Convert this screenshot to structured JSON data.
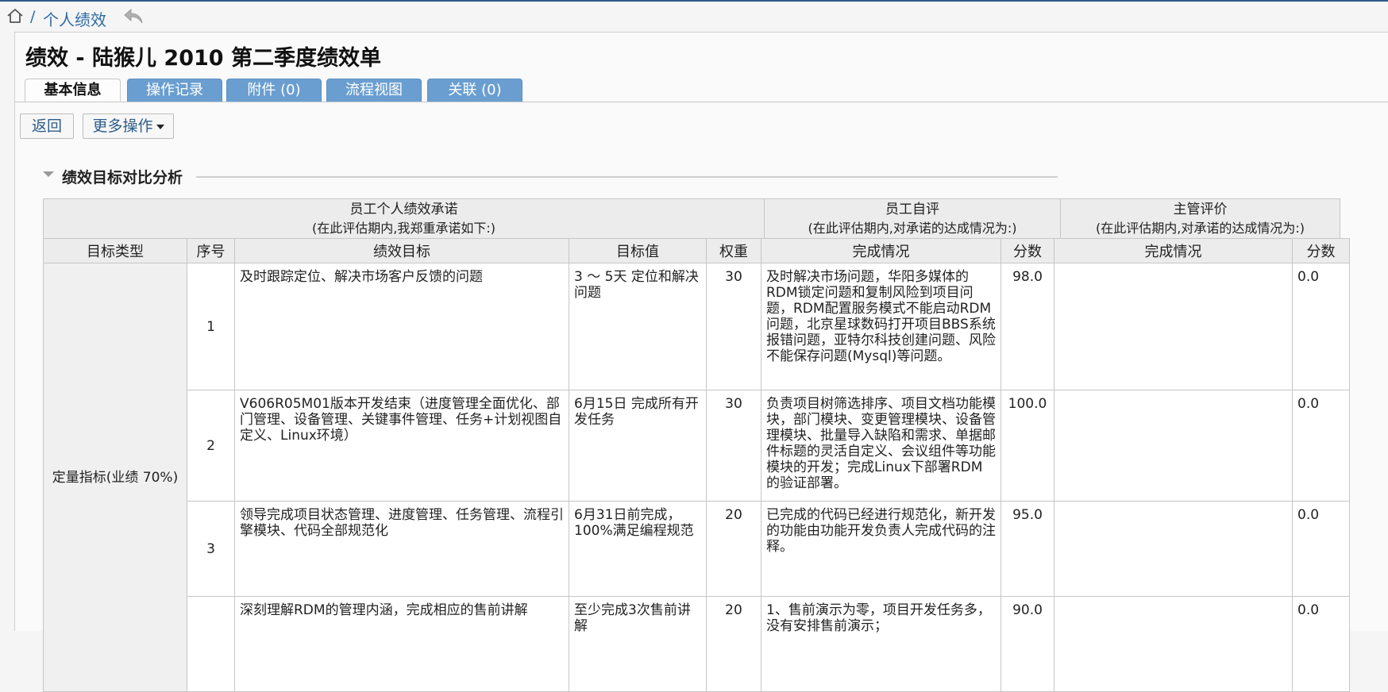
{
  "breadcrumb": {
    "separator": "/",
    "current": "个人绩效"
  },
  "page": {
    "title": "绩效 - 陆猴儿 2010 第二季度绩效单"
  },
  "tabs": [
    {
      "label": "基本信息",
      "active": true
    },
    {
      "label": "操作记录",
      "active": false
    },
    {
      "label": "附件 (0)",
      "active": false
    },
    {
      "label": "流程视图",
      "active": false
    },
    {
      "label": "关联 (0)",
      "active": false
    }
  ],
  "toolbar": {
    "back_label": "返回",
    "more_label": "更多操作"
  },
  "section": {
    "title": "绩效目标对比分析"
  },
  "table": {
    "groups": [
      {
        "title": "员工个人绩效承诺",
        "subtitle": "(在此评估期内,我郑重承诺如下:)"
      },
      {
        "title": "员工自评",
        "subtitle": "(在此评估期内,对承诺的达成情况为:)"
      },
      {
        "title": "主管评价",
        "subtitle": "(在此评估期内,对承诺的达成情况为:)"
      }
    ],
    "columns": [
      "目标类型",
      "序号",
      "绩效目标",
      "目标值",
      "权重",
      "完成情况",
      "分数",
      "完成情况",
      "分数"
    ],
    "type_label": "定量指标(业绩 70%)",
    "rows": [
      {
        "no": "1",
        "goal": "及时跟踪定位、解决市场客户反馈的问题",
        "target": "3 ～ 5天 定位和解决问题",
        "weight": "30",
        "self_status": "及时解决市场问题，华阳多媒体的RDM锁定问题和复制风险到项目问题，RDM配置服务模式不能启动RDM问题，北京星球数码打开项目BBS系统报错问题，亚特尔科技创建问题、风险不能保存问题(Mysql)等问题。",
        "self_score": "98.0",
        "mgr_status": "",
        "mgr_score": "0.0"
      },
      {
        "no": "2",
        "goal": "V606R05M01版本开发结束（进度管理全面优化、部门管理、设备管理、关键事件管理、任务+计划视图自定义、Linux环境）",
        "target": "6月15日 完成所有开发任务",
        "weight": "30",
        "self_status": "负责项目树筛选排序、项目文档功能模块，部门模块、变更管理模块、设备管理模块、批量导入缺陷和需求、单据邮件标题的灵活自定义、会议组件等功能模块的开发；完成Linux下部署RDM的验证部署。",
        "self_score": "100.0",
        "mgr_status": "",
        "mgr_score": "0.0"
      },
      {
        "no": "3",
        "goal": "领导完成项目状态管理、进度管理、任务管理、流程引擎模块、代码全部规范化",
        "target": "6月31日前完成，100%满足编程规范",
        "weight": "20",
        "self_status": "已完成的代码已经进行规范化，新开发的功能由功能开发负责人完成代码的注释。",
        "self_score": "95.0",
        "mgr_status": "",
        "mgr_score": "0.0"
      },
      {
        "no": "",
        "goal": "深刻理解RDM的管理内涵，完成相应的售前讲解",
        "target": "至少完成3次售前讲解",
        "weight": "20",
        "self_status": "1、售前演示为零，项目开发任务多，没有安排售前演示；",
        "self_score": "90.0",
        "mgr_status": "",
        "mgr_score": "0.0"
      }
    ]
  }
}
